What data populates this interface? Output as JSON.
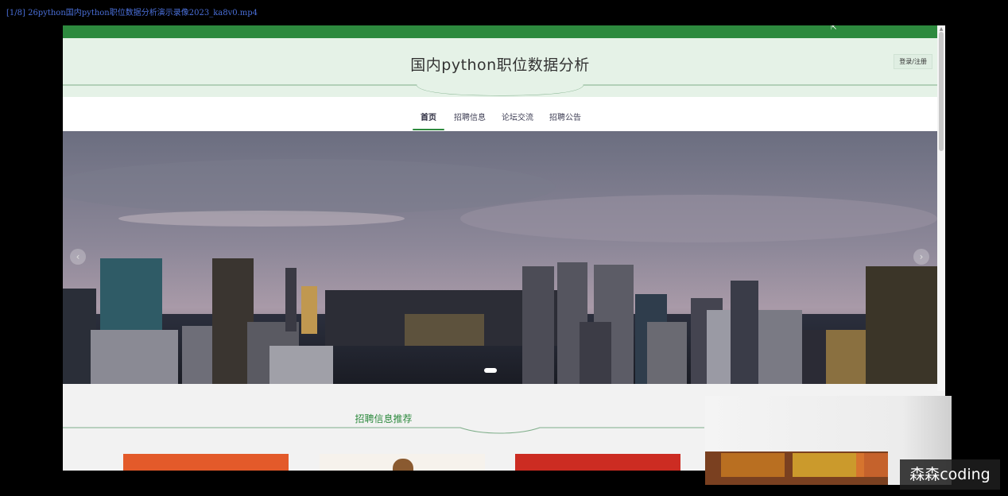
{
  "video": {
    "title": "[1/8] 26python国内python职位数据分析演示录像2023_ka8v0.mp4"
  },
  "site": {
    "title": "国内python职位数据分析",
    "login_label": "登录/注册"
  },
  "nav": {
    "items": [
      {
        "label": "首页",
        "active": true
      },
      {
        "label": "招聘信息"
      },
      {
        "label": "论坛交流"
      },
      {
        "label": "招聘公告"
      }
    ]
  },
  "carousel": {
    "prev": "‹",
    "next": "›",
    "slide_count": 1,
    "active_slide": 1
  },
  "section": {
    "title": "招聘信息推荐"
  },
  "watermark": {
    "text": "森森coding"
  },
  "colors": {
    "brand_green": "#2d8a3e",
    "header_bg": "#e5f2e7"
  }
}
